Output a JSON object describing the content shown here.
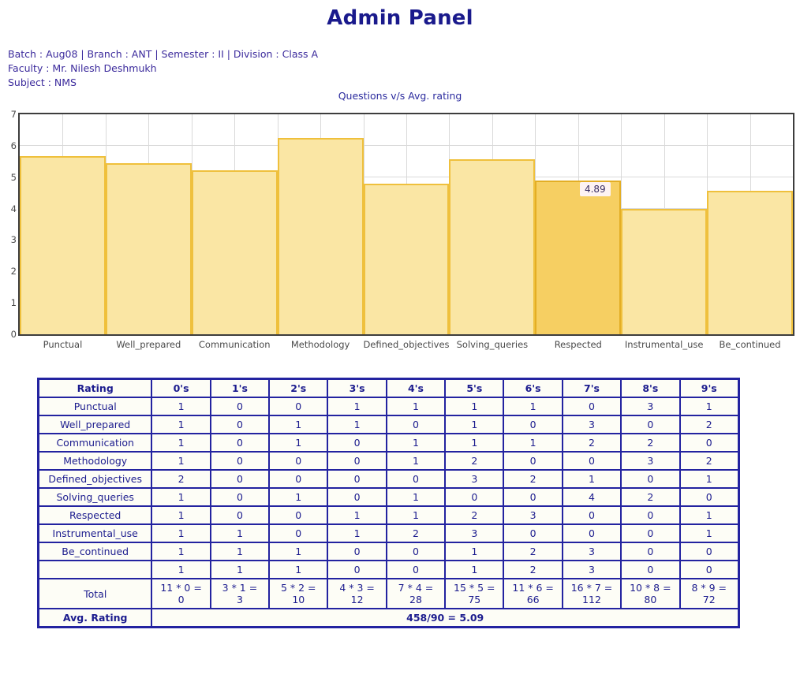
{
  "header": {
    "title": "Admin Panel",
    "meta_lines": [
      "Batch : Aug08 | Branch : ANT | Semester : II | Division : Class A",
      "Faculty : Mr. Nilesh Deshmukh",
      "Subject : NMS"
    ]
  },
  "chart_data": {
    "type": "bar",
    "title": "Questions v/s Avg. rating",
    "xlabel": "",
    "ylabel": "",
    "ylim": [
      0,
      7
    ],
    "yticks": [
      0,
      1,
      2,
      3,
      4,
      5,
      6,
      7
    ],
    "grid": true,
    "legend": null,
    "categories": [
      "Punctual",
      "Well_prepared",
      "Communication",
      "Methodology",
      "Defined_objectives",
      "Solving_queries",
      "Respected",
      "Instrumental_use",
      "Be_continued"
    ],
    "values": [
      5.67,
      5.44,
      5.22,
      6.25,
      4.78,
      5.56,
      4.89,
      4.0,
      4.56
    ],
    "highlighted_index": 6,
    "annotations": [
      {
        "index": 6,
        "label": "4.89"
      }
    ],
    "colors": {
      "bar_fill": "#fae6a4",
      "bar_border": "#efc03c",
      "highlight_fill": "#f6cf62",
      "highlight_border": "#e3ae25",
      "plot_border": "#3d3d3d",
      "grid": "#d9d9d9"
    }
  },
  "table": {
    "columns": [
      "Rating",
      "0's",
      "1's",
      "2's",
      "3's",
      "4's",
      "5's",
      "6's",
      "7's",
      "8's",
      "9's"
    ],
    "rows": [
      {
        "label": "Punctual",
        "values": [
          "1",
          "0",
          "0",
          "1",
          "1",
          "1",
          "1",
          "0",
          "3",
          "1"
        ]
      },
      {
        "label": "Well_prepared",
        "values": [
          "1",
          "0",
          "1",
          "1",
          "0",
          "1",
          "0",
          "3",
          "0",
          "2"
        ]
      },
      {
        "label": "Communication",
        "values": [
          "1",
          "0",
          "1",
          "0",
          "1",
          "1",
          "1",
          "2",
          "2",
          "0"
        ]
      },
      {
        "label": "Methodology",
        "values": [
          "1",
          "0",
          "0",
          "0",
          "1",
          "2",
          "0",
          "0",
          "3",
          "2"
        ]
      },
      {
        "label": "Defined_objectives",
        "values": [
          "2",
          "0",
          "0",
          "0",
          "0",
          "3",
          "2",
          "1",
          "0",
          "1"
        ]
      },
      {
        "label": "Solving_queries",
        "values": [
          "1",
          "0",
          "1",
          "0",
          "1",
          "0",
          "0",
          "4",
          "2",
          "0"
        ]
      },
      {
        "label": "Respected",
        "values": [
          "1",
          "0",
          "0",
          "1",
          "1",
          "2",
          "3",
          "0",
          "0",
          "1"
        ]
      },
      {
        "label": "Instrumental_use",
        "values": [
          "1",
          "1",
          "0",
          "1",
          "2",
          "3",
          "0",
          "0",
          "0",
          "1"
        ]
      },
      {
        "label": "Be_continued",
        "values": [
          "1",
          "1",
          "1",
          "0",
          "0",
          "1",
          "2",
          "3",
          "0",
          "0"
        ]
      },
      {
        "label": "",
        "values": [
          "1",
          "1",
          "1",
          "0",
          "0",
          "1",
          "2",
          "3",
          "0",
          "0"
        ]
      }
    ],
    "total_row": {
      "label": "Total",
      "values": [
        "11 * 0 = 0",
        "3 * 1 = 3",
        "5 * 2 = 10",
        "4 * 3 = 12",
        "7 * 4 = 28",
        "15 * 5 = 75",
        "11 * 6 = 66",
        "16 * 7 = 112",
        "10 * 8 = 80",
        "8 * 9 = 72"
      ]
    },
    "avg_row": {
      "label": "Avg. Rating",
      "value": "458/90 = 5.09"
    }
  }
}
